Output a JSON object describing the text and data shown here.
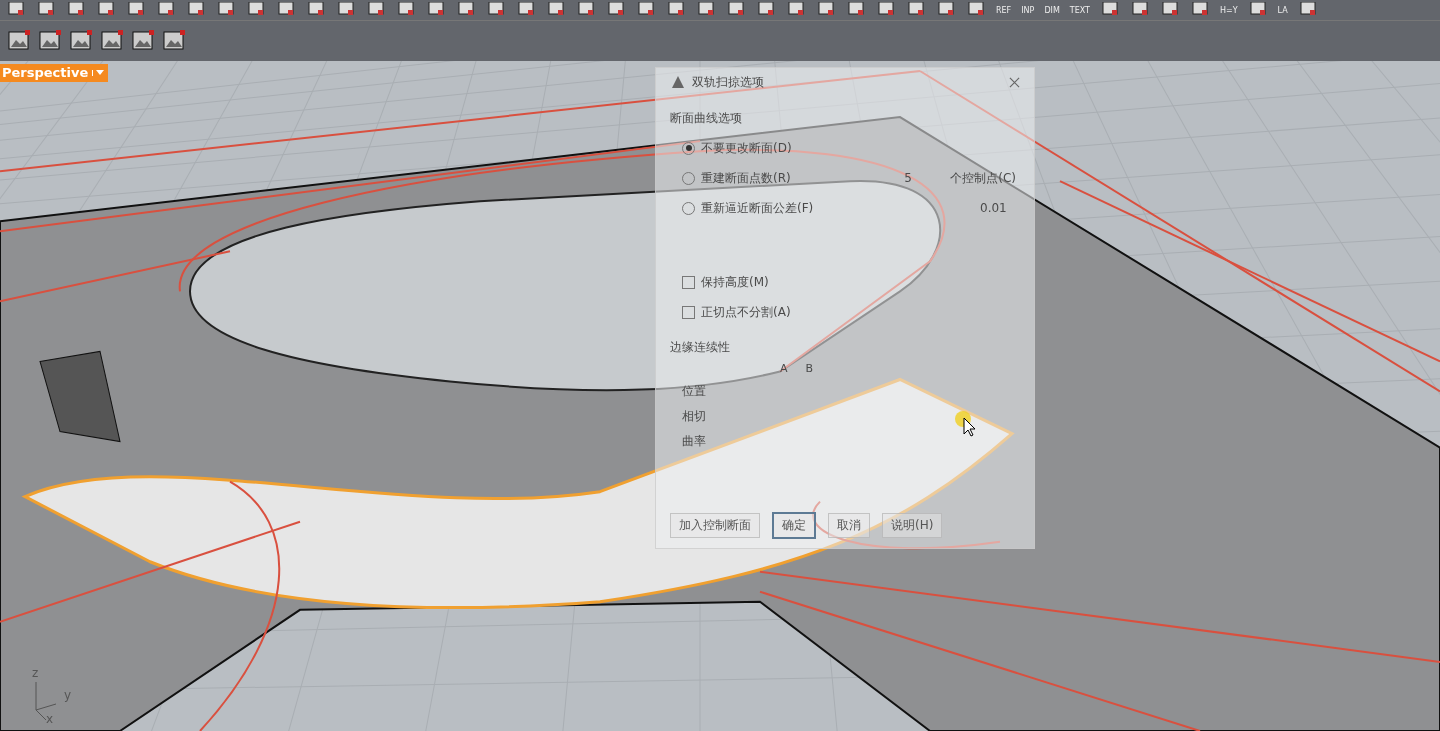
{
  "toolbar_top": {
    "buttons": [
      {
        "kind": "icon"
      },
      {
        "kind": "icon"
      },
      {
        "kind": "icon"
      },
      {
        "kind": "icon"
      },
      {
        "kind": "icon"
      },
      {
        "kind": "icon"
      },
      {
        "kind": "icon"
      },
      {
        "kind": "icon"
      },
      {
        "kind": "icon"
      },
      {
        "kind": "icon"
      },
      {
        "kind": "icon"
      },
      {
        "kind": "icon"
      },
      {
        "kind": "icon"
      },
      {
        "kind": "icon"
      },
      {
        "kind": "icon"
      },
      {
        "kind": "icon"
      },
      {
        "kind": "icon"
      },
      {
        "kind": "icon"
      },
      {
        "kind": "icon"
      },
      {
        "kind": "icon"
      },
      {
        "kind": "icon"
      },
      {
        "kind": "icon"
      },
      {
        "kind": "icon"
      },
      {
        "kind": "icon"
      },
      {
        "kind": "icon"
      },
      {
        "kind": "icon"
      },
      {
        "kind": "icon"
      },
      {
        "kind": "icon"
      },
      {
        "kind": "icon"
      },
      {
        "kind": "icon"
      },
      {
        "kind": "icon"
      },
      {
        "kind": "icon"
      },
      {
        "kind": "icon"
      },
      {
        "kind": "text",
        "label": "REF"
      },
      {
        "kind": "text",
        "label": "INP"
      },
      {
        "kind": "text",
        "label": "DIM"
      },
      {
        "kind": "text",
        "label": "TEXT"
      },
      {
        "kind": "icon"
      },
      {
        "kind": "icon"
      },
      {
        "kind": "icon"
      },
      {
        "kind": "icon"
      },
      {
        "kind": "text",
        "label": "H=Y"
      },
      {
        "kind": "icon"
      },
      {
        "kind": "text",
        "label": "LA"
      },
      {
        "kind": "icon"
      }
    ]
  },
  "viewport": {
    "label": "Perspective",
    "axes": {
      "z": "z",
      "y": "y",
      "x": "x"
    }
  },
  "dialog": {
    "title": "双轨扫掠选项",
    "section_title": "断面曲线选项",
    "options": [
      {
        "kind": "radio",
        "label": "不要更改断面(D)",
        "selected": true
      },
      {
        "kind": "radio",
        "label": "重建断面点数(R)",
        "selected": false,
        "value": "5",
        "unit": "个控制点(C)"
      },
      {
        "kind": "radio",
        "label": "重新逼近断面公差(F)",
        "selected": false,
        "value": "0.01"
      },
      {
        "kind": "checkbox",
        "label": "保持高度(M)",
        "checked": false
      },
      {
        "kind": "checkbox",
        "label": "正切点不分割(A)",
        "checked": false
      }
    ],
    "continuity": {
      "title": "边缘连续性",
      "columns": [
        "A",
        "B"
      ],
      "rows": [
        "位置",
        "相切",
        "曲率"
      ]
    },
    "buttons": [
      {
        "label": "加入控制断面",
        "default": false
      },
      {
        "label": "确定",
        "default": true
      },
      {
        "label": "取消",
        "default": false
      },
      {
        "label": "说明(H)",
        "default": false
      }
    ]
  }
}
